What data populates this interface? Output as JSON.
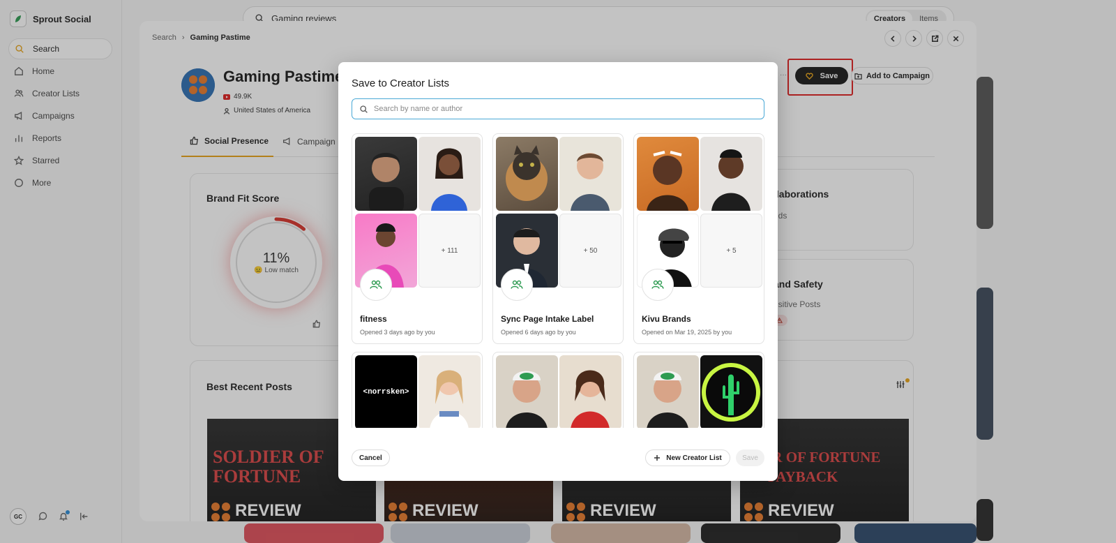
{
  "app": {
    "name": "Sprout Social"
  },
  "sidebar": {
    "items": [
      {
        "label": "Search",
        "icon": "search-icon"
      },
      {
        "label": "Home",
        "icon": "home-icon"
      },
      {
        "label": "Creator Lists",
        "icon": "users-icon"
      },
      {
        "label": "Campaigns",
        "icon": "megaphone-icon"
      },
      {
        "label": "Reports",
        "icon": "bar-chart-icon"
      },
      {
        "label": "Starred",
        "icon": "star-icon"
      },
      {
        "label": "More",
        "icon": "more-icon"
      }
    ],
    "user_initials": "GC"
  },
  "top_search": {
    "value": "Gaming reviews",
    "toggle": [
      "Creators",
      "Items"
    ],
    "toggle_selected": "Creators"
  },
  "profile": {
    "breadcrumb": [
      "Search",
      "Gaming Pastime"
    ],
    "name": "Gaming Pastime",
    "followers": "49.9K",
    "location": "United States of America",
    "save_label": "Save",
    "add_campaign_label": "Add to Campaign",
    "tabs": [
      "Social Presence",
      "Campaign"
    ],
    "brand_fit": {
      "title": "Brand Fit Score",
      "value": "11%",
      "label": "Low match",
      "fraction": 0.11
    },
    "collaborations_title": "llaborations",
    "collaborations_sub": "nds",
    "brand_safety_title": "and Safety",
    "brand_safety_sub": "nsitive Posts",
    "best_posts_title": "Best Recent Posts",
    "posts": [
      {
        "line1": "SOLDIER OF",
        "line2": "FORTUNE",
        "review": "REVIEW"
      },
      {
        "line1": "",
        "line2": "",
        "review": "REVIEW"
      },
      {
        "line1": "",
        "line2": "",
        "review": "REVIEW"
      },
      {
        "line1": "DIER OF FORTUNE",
        "line2": "PAYBACK",
        "review": "REVIEW"
      }
    ]
  },
  "modal": {
    "title": "Save to Creator Lists",
    "search_placeholder": "Search by name or author",
    "lists": [
      {
        "name": "fitness",
        "meta": "Opened 3 days ago by you",
        "more": "+ 111"
      },
      {
        "name": "Sync Page Intake Label",
        "meta": "Opened 6 days ago by you",
        "more": "+ 50"
      },
      {
        "name": "Kivu Brands",
        "meta": "Opened on Mar 19, 2025 by you",
        "more": "+ 5"
      }
    ],
    "second_row_text": "<norrsken>",
    "cancel_label": "Cancel",
    "new_list_label": "New Creator List",
    "save_label": "Save"
  },
  "colors": {
    "accent": "#e8a317",
    "highlight": "#e02020",
    "brand_green": "#2e9b52",
    "search_focus": "#49a8d6"
  }
}
